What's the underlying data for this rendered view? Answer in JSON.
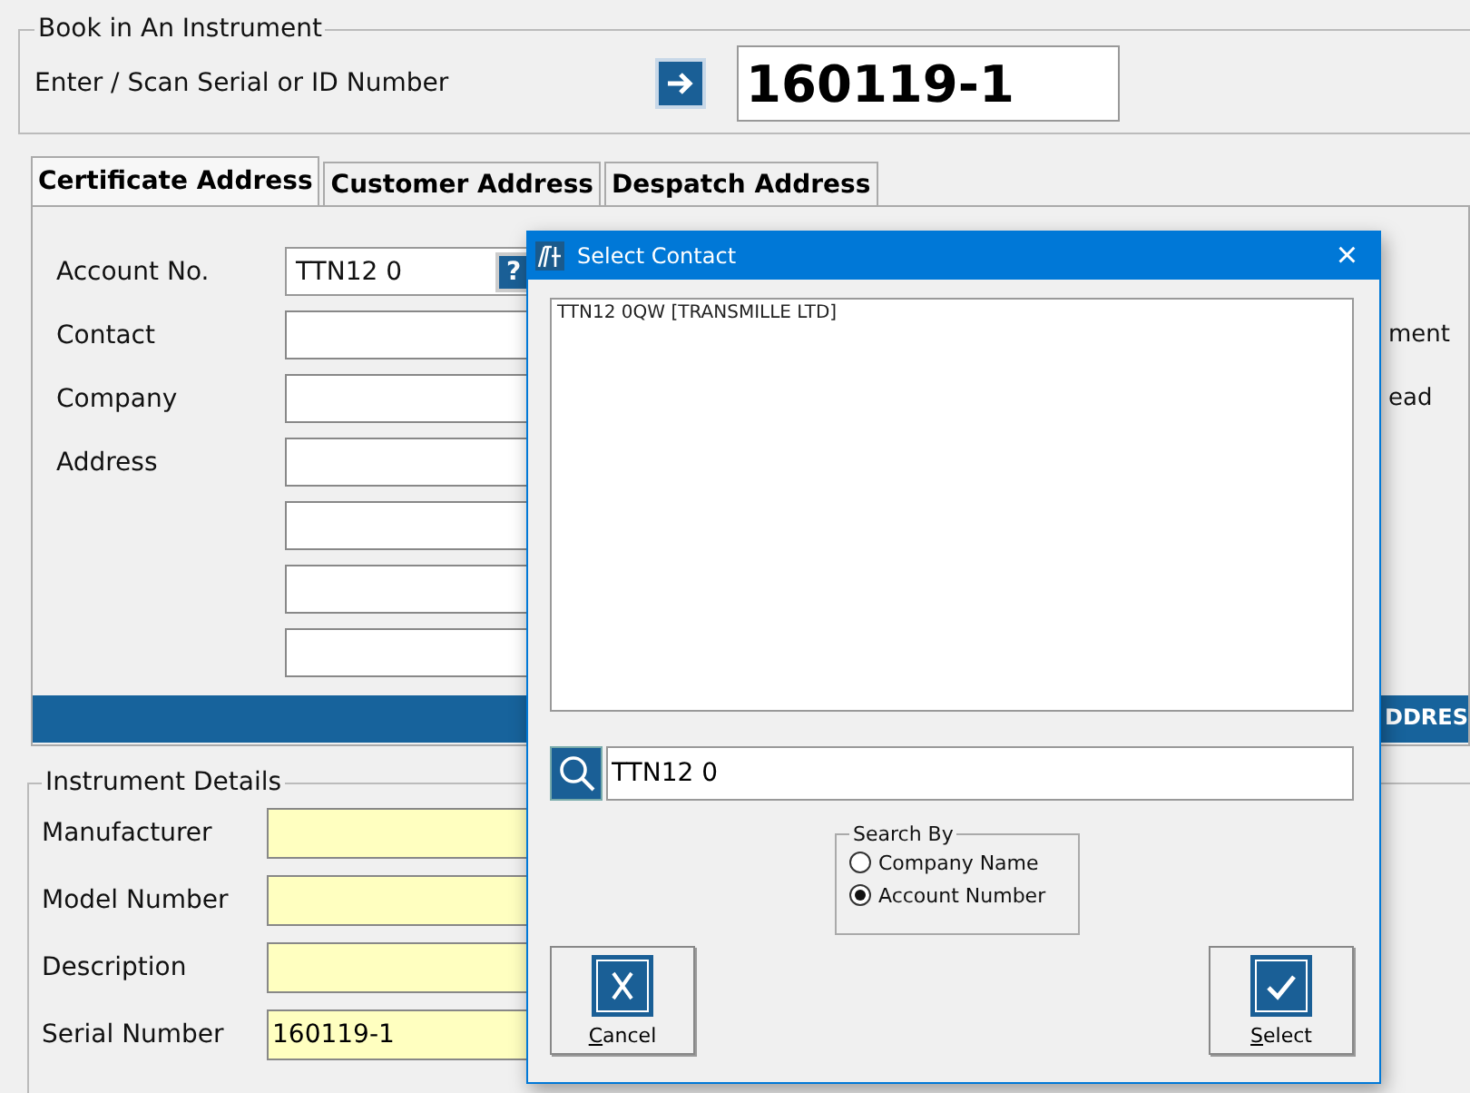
{
  "book_in": {
    "title": "Book in An Instrument",
    "label": "Enter / Scan Serial or ID Number",
    "value": "160119-1"
  },
  "tabs": [
    {
      "label": "Certificate Address",
      "selected": true
    },
    {
      "label": "Customer Address",
      "selected": false
    },
    {
      "label": "Despatch Address",
      "selected": false
    }
  ],
  "address_form": {
    "account_label": "Account No.",
    "account_value": "TTN12 0",
    "help_button": "?",
    "rows": [
      {
        "label": "Contact"
      },
      {
        "label": "Company"
      },
      {
        "label": "Address"
      },
      {},
      {},
      {}
    ],
    "right_labels": [
      "ment",
      "ead"
    ],
    "bar_text": "DDRES"
  },
  "instrument_details": {
    "title": "Instrument Details",
    "fields": [
      {
        "label": "Manufacturer"
      },
      {
        "label": "Model Number"
      },
      {
        "label": "Description"
      },
      {
        "label": "Serial Number",
        "value": "160119-1"
      }
    ]
  },
  "dialog": {
    "title": "Select Contact",
    "close": "×",
    "results": [
      {
        "text": "TTN12 0QW [TRANSMILLE LTD]",
        "selected": false
      }
    ],
    "search_value": "TTN12 0",
    "search_by": {
      "title": "Search By",
      "options": [
        {
          "label": "Company Name",
          "selected": false
        },
        {
          "label": "Account Number",
          "selected": true
        }
      ]
    },
    "buttons": [
      {
        "kind": "cancel",
        "label": "Cancel",
        "underline_first": true
      },
      {
        "kind": "select",
        "label": "Select",
        "underline_first": true
      }
    ]
  }
}
